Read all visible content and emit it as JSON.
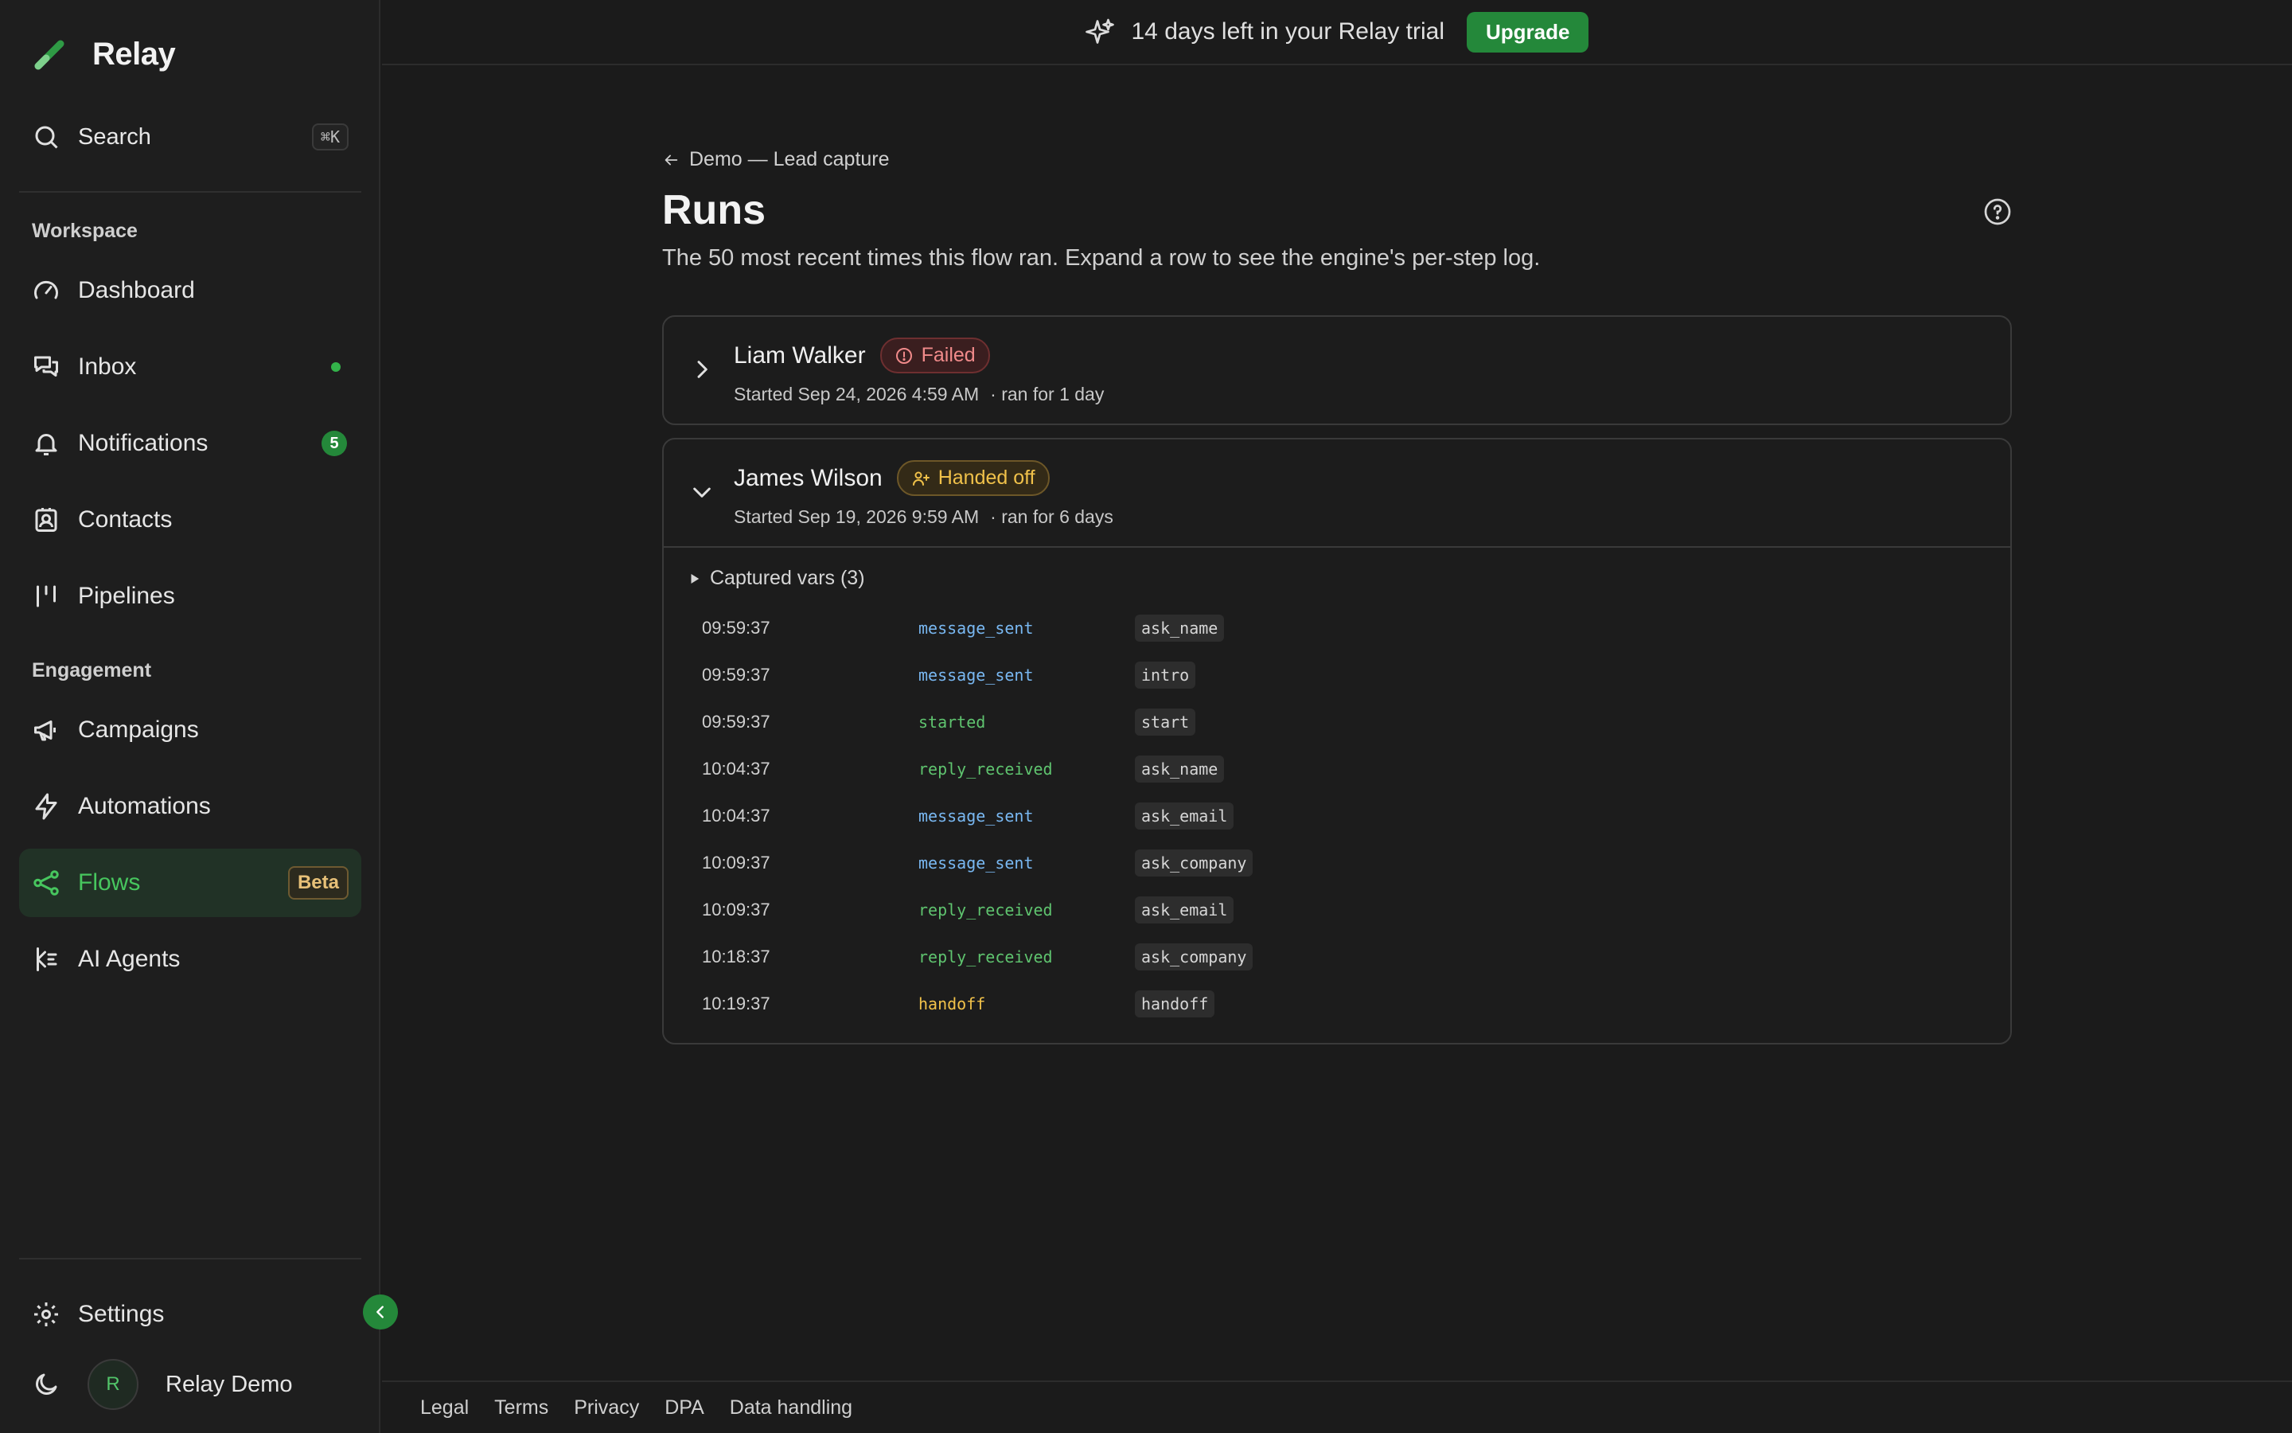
{
  "brand": {
    "name": "Relay",
    "accent": "#24883a"
  },
  "sidebar": {
    "search": {
      "label": "Search",
      "shortcut": "⌘K"
    },
    "sections": [
      {
        "title": "Workspace"
      },
      {
        "title": "Engagement"
      }
    ],
    "items": [
      {
        "label": "Dashboard",
        "icon": "gauge-icon"
      },
      {
        "label": "Inbox",
        "icon": "chat-bubbles-icon",
        "indicator": "dot"
      },
      {
        "label": "Notifications",
        "icon": "bell-icon",
        "badge": "5"
      },
      {
        "label": "Contacts",
        "icon": "contact-card-icon"
      },
      {
        "label": "Pipelines",
        "icon": "pipeline-columns-icon"
      },
      {
        "label": "Campaigns",
        "icon": "megaphone-icon"
      },
      {
        "label": "Automations",
        "icon": "lightning-icon"
      },
      {
        "label": "Flows",
        "icon": "flow-nodes-icon",
        "badge": "Beta",
        "active": true
      },
      {
        "label": "AI Agents",
        "icon": "brain-icon"
      }
    ],
    "settings": {
      "label": "Settings"
    },
    "user": {
      "initial": "R",
      "name": "Relay Demo"
    }
  },
  "topbar": {
    "trial_text": "14 days left in your Relay trial",
    "upgrade_label": "Upgrade"
  },
  "page": {
    "breadcrumb": "Demo — Lead capture",
    "title": "Runs",
    "subtitle": "The 50 most recent times this flow ran. Expand a row to see the engine's per-step log."
  },
  "runs": [
    {
      "name": "Liam Walker",
      "status": "Failed",
      "started": "Started Sep 24, 2026 4:59 AM",
      "duration": "· ran for 1 day",
      "expanded": false
    },
    {
      "name": "James Wilson",
      "status": "Handed off",
      "started": "Started Sep 19, 2026 9:59 AM",
      "duration": "· ran for 6 days",
      "expanded": true,
      "captured_label": "Captured vars (3)",
      "log": [
        {
          "time": "09:59:37",
          "event": "message_sent",
          "step": "ask_name"
        },
        {
          "time": "09:59:37",
          "event": "message_sent",
          "step": "intro"
        },
        {
          "time": "09:59:37",
          "event": "started",
          "step": "start"
        },
        {
          "time": "10:04:37",
          "event": "reply_received",
          "step": "ask_name"
        },
        {
          "time": "10:04:37",
          "event": "message_sent",
          "step": "ask_email"
        },
        {
          "time": "10:09:37",
          "event": "message_sent",
          "step": "ask_company"
        },
        {
          "time": "10:09:37",
          "event": "reply_received",
          "step": "ask_email"
        },
        {
          "time": "10:18:37",
          "event": "reply_received",
          "step": "ask_company"
        },
        {
          "time": "10:19:37",
          "event": "handoff",
          "step": "handoff"
        }
      ]
    }
  ],
  "footer": {
    "links": [
      "Legal",
      "Terms",
      "Privacy",
      "DPA",
      "Data handling"
    ]
  }
}
